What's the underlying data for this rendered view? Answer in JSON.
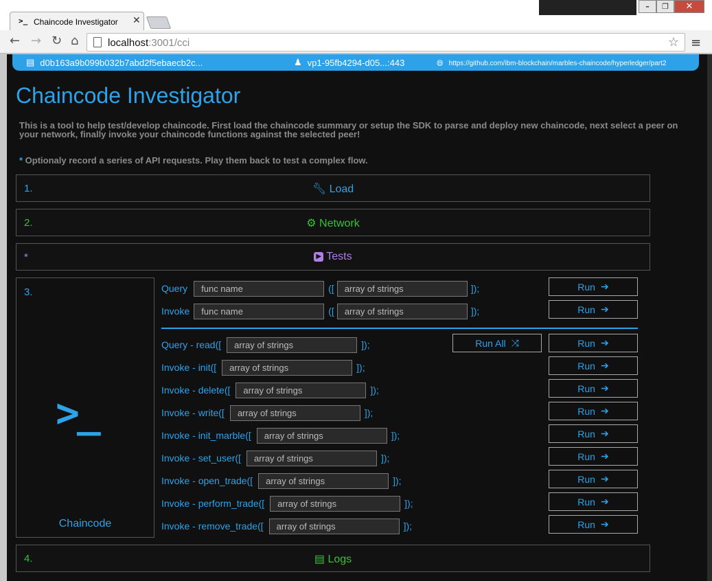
{
  "browser": {
    "tab_title": "Chaincode Investigator",
    "tab_icon": ">_",
    "url_host": "localhost",
    "url_rest": ":3001/cci"
  },
  "infobar": {
    "chaincode_id": "d0b163a9b099b032b7abd2f5ebaecb2c...",
    "peer": "vp1-95fb4294-d05...:443",
    "git_url": "https://github.com/ibm-blockchain/marbles-chaincode/hyperledger/part2"
  },
  "title": "Chaincode Investigator",
  "description": "This is a tool to help test/develop chaincode. First load the chaincode summary or setup the SDK to parse and deploy new chaincode, next select a peer on your network, finally invoke your chaincode functions against the selected peer!",
  "note_star": "*",
  "note": " Optionaly record a series of API requests. Play them back to test a complex flow.",
  "panels": [
    {
      "num": "1.",
      "label": "Load",
      "icon": "wrench-icon",
      "color": "#2ea2e9"
    },
    {
      "num": "2.",
      "label": "Network",
      "icon": "gears-icon",
      "color": "#35c335"
    },
    {
      "num": "*",
      "label": "Tests",
      "icon": "youtube-play-icon",
      "color": "#b07ee6"
    },
    {
      "num": "4.",
      "label": "Logs",
      "icon": "file-text-icon",
      "color": "#35c335"
    }
  ],
  "chaincode_panel": {
    "num": "3.",
    "icon_text": ">_",
    "caption": "Chaincode"
  },
  "generic": {
    "query_label": "Query",
    "invoke_label": "Invoke",
    "func_placeholder": "func name",
    "open_paren": "([",
    "close_paren": "]);",
    "args_placeholder": "array of strings"
  },
  "run_label": "Run",
  "run_all_label": "Run All",
  "functions": [
    {
      "prefix": "Query - read([",
      "suffix": "]);"
    },
    {
      "prefix": "Invoke - init([",
      "suffix": "]);"
    },
    {
      "prefix": "Invoke - delete([",
      "suffix": "]);"
    },
    {
      "prefix": "Invoke - write([",
      "suffix": "]);"
    },
    {
      "prefix": "Invoke - init_marble([",
      "suffix": "]);"
    },
    {
      "prefix": "Invoke - set_user([",
      "suffix": "]);"
    },
    {
      "prefix": "Invoke - open_trade([",
      "suffix": "]);"
    },
    {
      "prefix": "Invoke - perform_trade([",
      "suffix": "]);"
    },
    {
      "prefix": "Invoke - remove_trade([",
      "suffix": "]);"
    }
  ]
}
